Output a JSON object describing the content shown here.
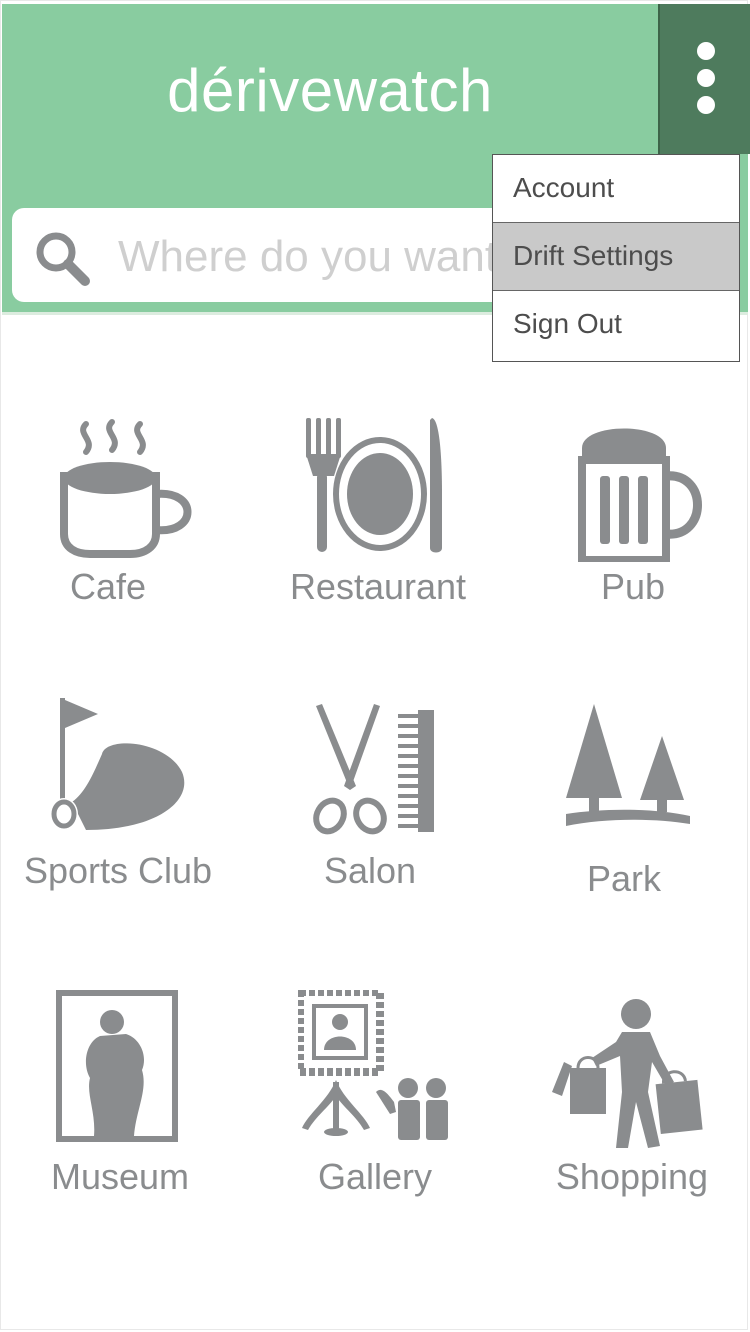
{
  "app": {
    "title": "dérivewatch"
  },
  "search": {
    "placeholder": "Where do you want to go?"
  },
  "menu": {
    "items": [
      {
        "label": "Account"
      },
      {
        "label": "Drift Settings"
      },
      {
        "label": "Sign Out"
      }
    ],
    "active_index": 1
  },
  "categories": [
    {
      "label": "Cafe",
      "icon": "coffee-cup-icon"
    },
    {
      "label": "Restaurant",
      "icon": "fork-plate-knife-icon"
    },
    {
      "label": "Pub",
      "icon": "beer-mug-icon"
    },
    {
      "label": "Sports Club",
      "icon": "golf-flag-icon"
    },
    {
      "label": "Salon",
      "icon": "scissors-comb-icon"
    },
    {
      "label": "Park",
      "icon": "trees-icon"
    },
    {
      "label": "Museum",
      "icon": "statue-frame-icon"
    },
    {
      "label": "Gallery",
      "icon": "gallery-picture-icon"
    },
    {
      "label": "Shopping",
      "icon": "shopper-bags-icon"
    }
  ],
  "colors": {
    "header": "#89cca0",
    "menu_button": "#4e7b5d",
    "icon_gray": "#8a8c8e",
    "menu_active": "#c9c9c9"
  }
}
